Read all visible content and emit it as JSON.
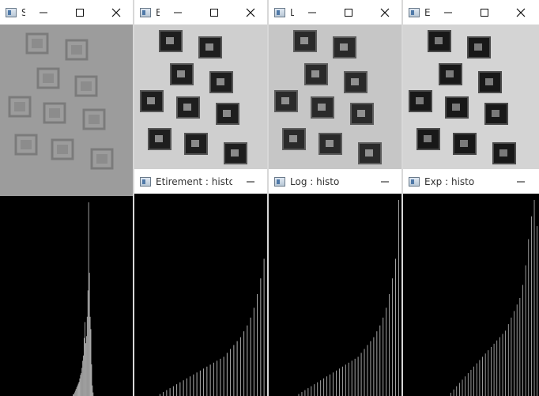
{
  "windows": {
    "source_image": {
      "title": "S"
    },
    "etirement_image": {
      "title": "E"
    },
    "log_image": {
      "title": "L"
    },
    "exp_image": {
      "title": "E"
    },
    "etirement_histo": {
      "title": "Etirement : histo"
    },
    "log_histo": {
      "title": "Log : histo"
    },
    "exp_histo": {
      "title": "Exp : histo"
    }
  },
  "colors": {
    "titlebar_bg": "#ffffff",
    "title_text": "#333333",
    "histogram_bg": "#000000",
    "histogram_bars": "#b8b8b8",
    "source_image_tone": "#9a9a9a",
    "processed_image_light": "#d2d2d2",
    "processed_image_dark": "#1e1e1e"
  },
  "icons": {
    "window_app": "window-app-icon",
    "minimize": "minimize-icon",
    "maximize": "maximize-icon",
    "close": "close-icon"
  },
  "histograms": {
    "source": [
      0,
      0,
      0,
      0,
      0,
      0,
      0,
      0,
      0,
      0,
      0,
      0,
      0,
      0,
      0,
      0,
      0,
      0,
      0,
      0,
      0,
      0,
      0,
      0,
      0,
      0,
      0,
      0,
      0,
      0,
      0,
      0,
      0,
      0,
      0,
      0,
      0,
      0,
      0,
      0,
      0,
      0,
      0,
      0,
      0,
      0,
      0,
      0,
      0,
      0,
      0,
      0,
      0,
      0,
      0,
      0,
      0,
      0,
      0,
      0,
      0,
      0,
      0,
      0,
      0,
      0,
      0,
      0,
      0,
      0,
      0,
      0,
      0,
      0,
      0,
      0,
      0,
      0,
      0,
      0,
      0,
      0,
      0,
      0,
      0,
      0,
      0,
      0,
      0,
      0,
      0,
      0,
      0,
      0,
      0,
      0,
      0,
      0,
      1,
      1,
      2,
      3,
      4,
      5,
      6,
      7,
      8,
      10,
      12,
      13,
      16,
      20,
      23,
      33,
      42,
      30,
      34,
      45,
      60,
      110,
      70,
      45,
      38,
      18,
      6,
      2,
      0,
      0,
      0,
      0,
      0,
      0,
      0,
      0,
      0,
      0,
      0,
      0,
      0,
      0,
      0,
      0,
      0,
      0,
      0,
      0,
      0,
      0,
      0,
      0,
      0,
      0,
      0,
      0,
      0,
      0,
      0,
      0,
      0,
      0,
      0,
      0,
      0,
      0,
      0,
      0,
      0,
      0,
      0,
      0,
      0,
      0,
      0,
      0,
      0,
      0,
      0,
      0,
      0,
      0,
      0
    ],
    "stretched": [
      0,
      0,
      0,
      0,
      0,
      0,
      0,
      0,
      0,
      0,
      0,
      0,
      0,
      0,
      0,
      0,
      0,
      0,
      0,
      0,
      0,
      0,
      0,
      0,
      0,
      0,
      0,
      0,
      0,
      0,
      1,
      0,
      0,
      0,
      2,
      0,
      0,
      0,
      3,
      0,
      0,
      0,
      4,
      0,
      0,
      0,
      5,
      0,
      0,
      0,
      6,
      0,
      0,
      0,
      7,
      0,
      0,
      0,
      8,
      0,
      0,
      0,
      9,
      0,
      0,
      0,
      10,
      0,
      0,
      0,
      11,
      0,
      0,
      0,
      12,
      0,
      0,
      0,
      13,
      0,
      0,
      0,
      14,
      0,
      0,
      0,
      15,
      0,
      0,
      0,
      16,
      0,
      0,
      0,
      17,
      0,
      0,
      0,
      18,
      0,
      0,
      0,
      19,
      0,
      0,
      0,
      20,
      0,
      0,
      0,
      22,
      0,
      0,
      0,
      24,
      0,
      0,
      0,
      26,
      0,
      0,
      0,
      28,
      0,
      0,
      0,
      30,
      0,
      0,
      0,
      33,
      0,
      0,
      0,
      36,
      0,
      0,
      0,
      40,
      0,
      0,
      0,
      45,
      0,
      0,
      0,
      52,
      0,
      0,
      0,
      60,
      0,
      0,
      0,
      70,
      0,
      0,
      0,
      100,
      0
    ],
    "log": [
      0,
      0,
      0,
      0,
      0,
      0,
      0,
      0,
      0,
      0,
      0,
      0,
      0,
      0,
      0,
      0,
      0,
      0,
      0,
      0,
      0,
      0,
      0,
      0,
      0,
      0,
      0,
      0,
      0,
      0,
      0,
      0,
      0,
      0,
      0,
      0,
      0,
      0,
      1,
      0,
      0,
      0,
      2,
      0,
      0,
      0,
      3,
      0,
      0,
      0,
      4,
      0,
      0,
      0,
      5,
      0,
      0,
      0,
      6,
      0,
      0,
      0,
      7,
      0,
      0,
      0,
      8,
      0,
      0,
      0,
      9,
      0,
      0,
      0,
      10,
      0,
      0,
      0,
      11,
      0,
      0,
      0,
      12,
      0,
      0,
      0,
      13,
      0,
      0,
      0,
      14,
      0,
      0,
      0,
      15,
      0,
      0,
      0,
      16,
      0,
      0,
      0,
      17,
      0,
      0,
      0,
      18,
      0,
      0,
      0,
      19,
      0,
      0,
      0,
      20,
      0,
      0,
      0,
      22,
      0,
      0,
      0,
      24,
      0,
      0,
      0,
      26,
      0,
      0,
      0,
      28,
      0,
      0,
      0,
      30,
      0,
      0,
      0,
      33,
      0,
      0,
      0,
      36,
      0,
      0,
      0,
      40,
      0,
      0,
      0,
      45,
      0,
      0,
      0,
      52,
      0,
      0,
      0,
      60,
      0,
      0,
      0,
      70,
      0,
      0,
      0,
      100,
      0,
      0,
      0,
      0,
      0
    ],
    "exp": [
      0,
      0,
      0,
      0,
      0,
      0,
      0,
      0,
      0,
      0,
      0,
      0,
      0,
      0,
      0,
      0,
      0,
      0,
      0,
      0,
      0,
      0,
      0,
      0,
      0,
      0,
      0,
      0,
      0,
      0,
      0,
      0,
      0,
      0,
      0,
      0,
      0,
      0,
      0,
      0,
      0,
      0,
      0,
      0,
      0,
      0,
      0,
      0,
      0,
      0,
      0,
      0,
      0,
      0,
      0,
      0,
      0,
      0,
      0,
      0,
      0,
      0,
      0,
      0,
      0,
      0,
      1,
      0,
      0,
      0,
      2,
      0,
      0,
      0,
      3,
      0,
      0,
      0,
      4,
      0,
      0,
      0,
      5,
      0,
      0,
      0,
      6,
      0,
      0,
      0,
      7,
      0,
      0,
      0,
      8,
      0,
      0,
      0,
      9,
      0,
      0,
      0,
      10,
      0,
      0,
      0,
      11,
      0,
      0,
      0,
      12,
      0,
      0,
      0,
      13,
      0,
      0,
      0,
      14,
      0,
      0,
      0,
      15,
      0,
      0,
      0,
      16,
      0,
      0,
      0,
      17,
      0,
      0,
      0,
      18,
      0,
      0,
      0,
      19,
      0,
      0,
      0,
      20,
      0,
      0,
      0,
      22,
      0,
      0,
      0,
      24,
      0,
      0,
      0,
      26,
      0,
      0,
      0,
      28,
      0,
      0,
      0,
      30,
      0,
      0,
      0,
      34,
      0,
      0,
      0,
      40,
      0,
      0,
      0,
      48,
      0,
      0,
      0,
      55,
      0,
      0,
      0,
      60,
      0,
      0,
      0,
      52,
      0,
      0
    ]
  }
}
